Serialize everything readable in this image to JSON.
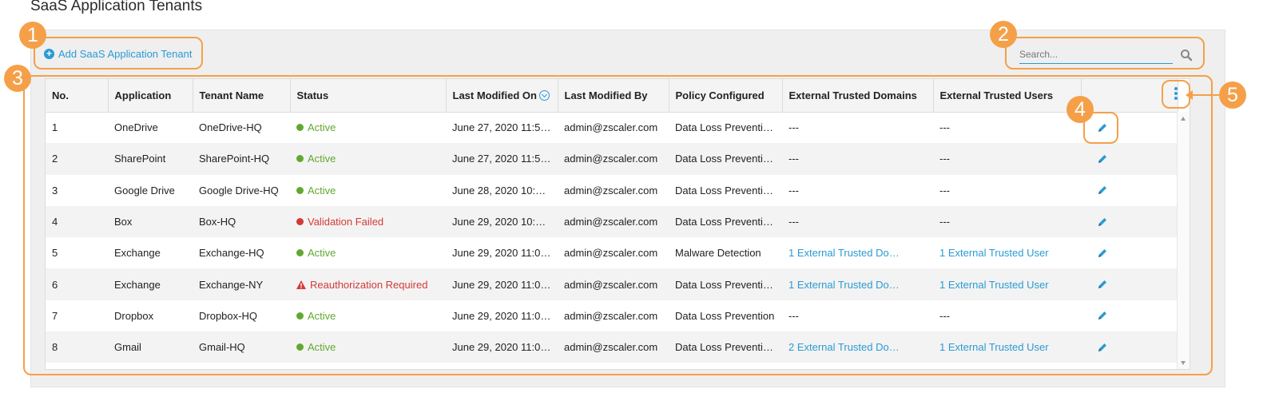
{
  "page": {
    "title": "SaaS Application Tenants"
  },
  "toolbar": {
    "add_label": "Add SaaS Application Tenant"
  },
  "search": {
    "placeholder": "Search..."
  },
  "table": {
    "headers": {
      "no": "No.",
      "application": "Application",
      "tenant": "Tenant Name",
      "status": "Status",
      "modified_on": "Last Modified On",
      "modified_by": "Last Modified By",
      "policy": "Policy Configured",
      "domains": "External Trusted Domains",
      "users": "External Trusted Users"
    },
    "rows": [
      {
        "no": "1",
        "application": "OneDrive",
        "tenant": "OneDrive-HQ",
        "status": "Active",
        "status_type": "ok",
        "modified_on": "June 27, 2020 11:5…",
        "modified_by": "admin@zscaler.com",
        "policy": "Data Loss Preventi…",
        "domains": "---",
        "users": "---"
      },
      {
        "no": "2",
        "application": "SharePoint",
        "tenant": "SharePoint-HQ",
        "status": "Active",
        "status_type": "ok",
        "modified_on": "June 27, 2020 11:5…",
        "modified_by": "admin@zscaler.com",
        "policy": "Data Loss Preventi…",
        "domains": "---",
        "users": "---"
      },
      {
        "no": "3",
        "application": "Google Drive",
        "tenant": "Google Drive-HQ",
        "status": "Active",
        "status_type": "ok",
        "modified_on": "June 28, 2020 10:1…",
        "modified_by": "admin@zscaler.com",
        "policy": "Data Loss Preventi…",
        "domains": "---",
        "users": "---"
      },
      {
        "no": "4",
        "application": "Box",
        "tenant": "Box-HQ",
        "status": "Validation Failed",
        "status_type": "fail",
        "modified_on": "June 29, 2020 10:5…",
        "modified_by": "admin@zscaler.com",
        "policy": "Data Loss Preventi…",
        "domains": "---",
        "users": "---"
      },
      {
        "no": "5",
        "application": "Exchange",
        "tenant": "Exchange-HQ",
        "status": "Active",
        "status_type": "ok",
        "modified_on": "June 29, 2020 11:0…",
        "modified_by": "admin@zscaler.com",
        "policy": "Malware Detection",
        "domains": "1 External Trusted Do…",
        "users": "1 External Trusted User"
      },
      {
        "no": "6",
        "application": "Exchange",
        "tenant": "Exchange-NY",
        "status": "Reauthorization Required",
        "status_type": "warn",
        "modified_on": "June 29, 2020 11:0…",
        "modified_by": "admin@zscaler.com",
        "policy": "Data Loss Preventi…",
        "domains": "1 External Trusted Do…",
        "users": "1 External Trusted User"
      },
      {
        "no": "7",
        "application": "Dropbox",
        "tenant": "Dropbox-HQ",
        "status": "Active",
        "status_type": "ok",
        "modified_on": "June 29, 2020 11:0…",
        "modified_by": "admin@zscaler.com",
        "policy": "Data Loss Prevention",
        "domains": "---",
        "users": "---"
      },
      {
        "no": "8",
        "application": "Gmail",
        "tenant": "Gmail-HQ",
        "status": "Active",
        "status_type": "ok",
        "modified_on": "June 29, 2020 11:0…",
        "modified_by": "admin@zscaler.com",
        "policy": "Data Loss Preventi…",
        "domains": "2 External Trusted Do…",
        "users": "1 External Trusted User"
      }
    ]
  },
  "callouts": {
    "c1": "1",
    "c2": "2",
    "c3": "3",
    "c4": "4",
    "c5": "5"
  },
  "colors": {
    "accent": "#2a9bd3",
    "active": "#62a830",
    "error": "#d33a36",
    "callout": "#f5a048"
  },
  "icons": {
    "add": "plus-circle-icon",
    "search": "search-icon",
    "edit": "pencil-icon",
    "sort": "chevron-down-circle-icon",
    "columns": "kebab-menu-icon"
  }
}
